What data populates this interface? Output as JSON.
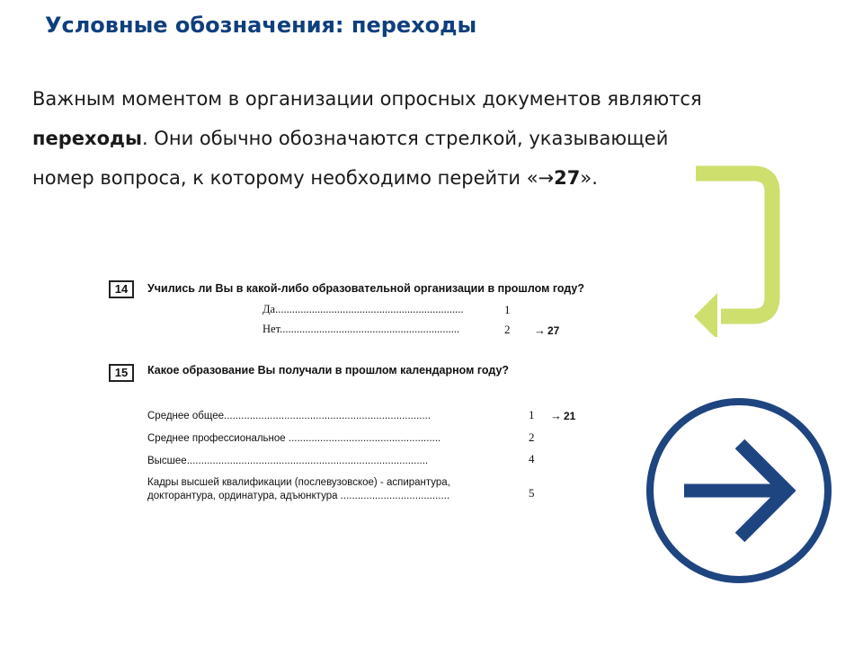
{
  "title": "Условные обозначения: переходы",
  "intro": {
    "line1": "Важным моментом в организации опросных документов являются",
    "line2_bold": "переходы",
    "line2_rest": ". Они обычно обозначаются стрелкой, указывающей",
    "line3_pre": "номер вопроса, к которому необходимо перейти «",
    "line3_arrow": "→",
    "line3_num": "27",
    "line3_post": "»."
  },
  "questions": [
    {
      "number": "14",
      "text": "Учились ли Вы  в какой-либо образовательной организации в прошлом году?",
      "answers": [
        {
          "label": "Да",
          "dots": "...................................................................",
          "code": "1",
          "jump": ""
        },
        {
          "label": "Нет",
          "dots": "................................................................",
          "code": "2",
          "jump": "27"
        }
      ]
    },
    {
      "number": "15",
      "text": "Какое образование Вы получали в прошлом календарном году?",
      "answers": [
        {
          "label": "Среднее  общее",
          "dots": "........................................................................",
          "code": "1",
          "jump": "21"
        },
        {
          "label": "Среднее профессиональное",
          "dots": "  .....................................................",
          "code": "2",
          "jump": ""
        },
        {
          "label": "Высшее",
          "dots": "....................................................................................",
          "code": "4",
          "jump": ""
        },
        {
          "label": "Кадры высшей квалификации (послевузовское) - аспирантура,",
          "label2": "докторантура, ординатура, адъюнктура",
          "dots": " ......................................",
          "code": "5",
          "jump": ""
        }
      ]
    }
  ],
  "jump_arrow": "→",
  "icons": {
    "return_arrow": "curved-return-arrow-icon",
    "circle_arrow": "circle-right-arrow-icon"
  },
  "colors": {
    "title": "#0f3f7d",
    "return_arrow": "#cfdf6e",
    "circle_arrow": "#1f4580"
  }
}
